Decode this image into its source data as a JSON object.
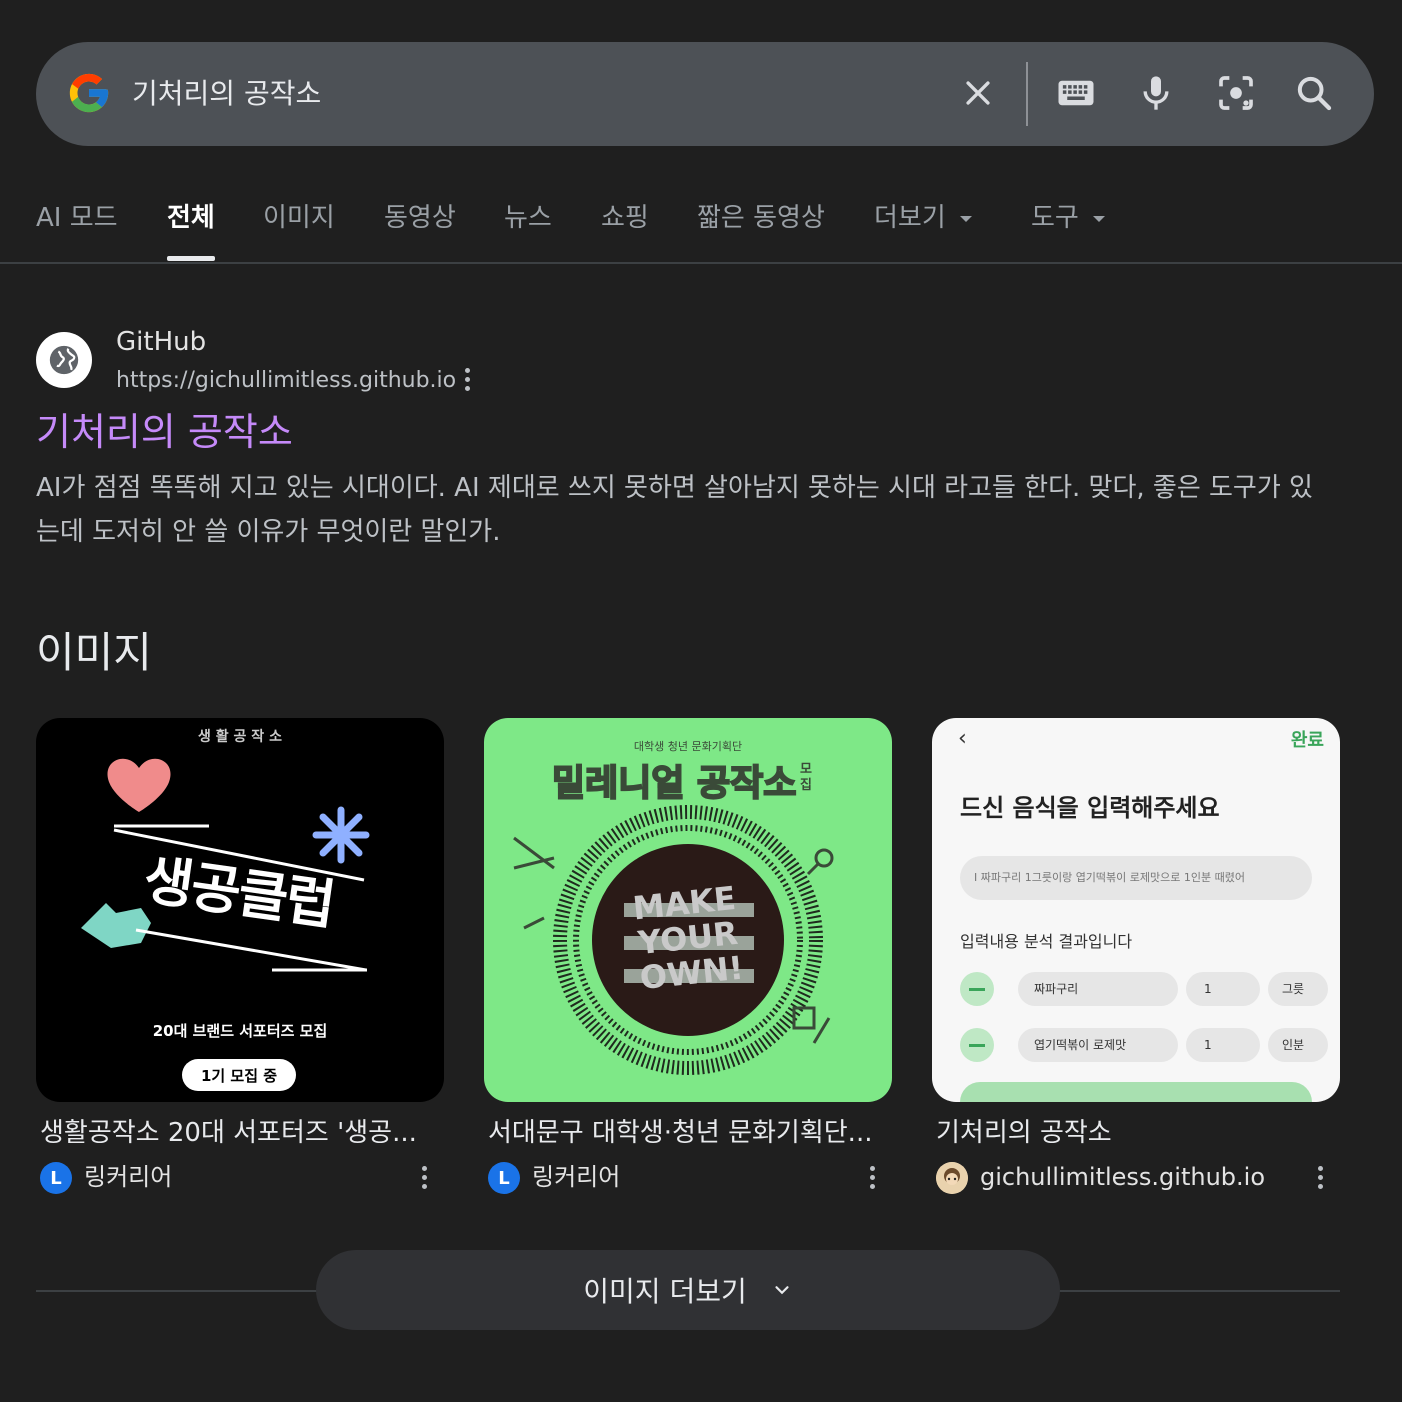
{
  "search": {
    "query": "기처리의 공작소",
    "icons": [
      "google-logo",
      "clear-icon",
      "keyboard-icon",
      "mic-icon",
      "lens-icon",
      "search-icon"
    ]
  },
  "tabs": [
    {
      "label": "AI 모드",
      "active": false
    },
    {
      "label": "전체",
      "active": true
    },
    {
      "label": "이미지",
      "active": false
    },
    {
      "label": "동영상",
      "active": false
    },
    {
      "label": "뉴스",
      "active": false
    },
    {
      "label": "쇼핑",
      "active": false
    },
    {
      "label": "짧은 동영상",
      "active": false
    },
    {
      "label": "더보기",
      "active": false,
      "dropdown": true
    },
    {
      "label": "도구",
      "active": false,
      "dropdown": true
    }
  ],
  "result": {
    "site_name": "GitHub",
    "url": "https://gichullimitless.github.io",
    "title": "기처리의 공작소",
    "snippet": "AI가 점점 똑똑해 지고 있는 시대이다. AI 제대로 쓰지 못하면 살아남지 못하는 시대 라고들 한다. 맞다, 좋은 도구가 있는데 도저히 안 쓸 이유가 무엇이란 말인가."
  },
  "images_section": {
    "title": "이미지",
    "cards": [
      {
        "title": "생활공작소 20대 서포터즈 '생공...",
        "source": "링커리어",
        "badge": "L",
        "thumb": {
          "header": "생 활 공 작 소",
          "main": "생공클럽",
          "sub": "20대 브랜드 서포터즈 모집",
          "pill": "1기 모집 중"
        }
      },
      {
        "title": "서대문구 대학생·청년 문화기획단...",
        "source": "링커리어",
        "badge": "L",
        "thumb": {
          "header": "대학생 청년 문화기획단",
          "main": "밀레니얼 공작소",
          "side": "모집",
          "center": [
            "MAKE",
            "YOUR",
            "OWN!"
          ]
        }
      },
      {
        "title": "기처리의 공작소",
        "source": "gichullimitless.github.io",
        "badge": "avatar",
        "thumb": {
          "done": "완료",
          "heading": "드신 음식을 입력해주세요",
          "input": "I 짜파구리 1그릇이랑 엽기떡볶이 로제맛으로 1인분 때렸어",
          "result_label": "입력내용 분석 결과입니다",
          "rows": [
            {
              "name": "짜파구리",
              "qty": "1",
              "unit": "그릇"
            },
            {
              "name": "엽기떡볶이 로제맛",
              "qty": "1",
              "unit": "인분"
            }
          ]
        }
      }
    ],
    "more_button": "이미지 더보기"
  },
  "colors": {
    "background": "#1f1f1f",
    "search_bar": "#4d5156",
    "link_visited": "#c58af9",
    "thumb2_green": "#7ee887",
    "badge_blue": "#1a73e8"
  }
}
